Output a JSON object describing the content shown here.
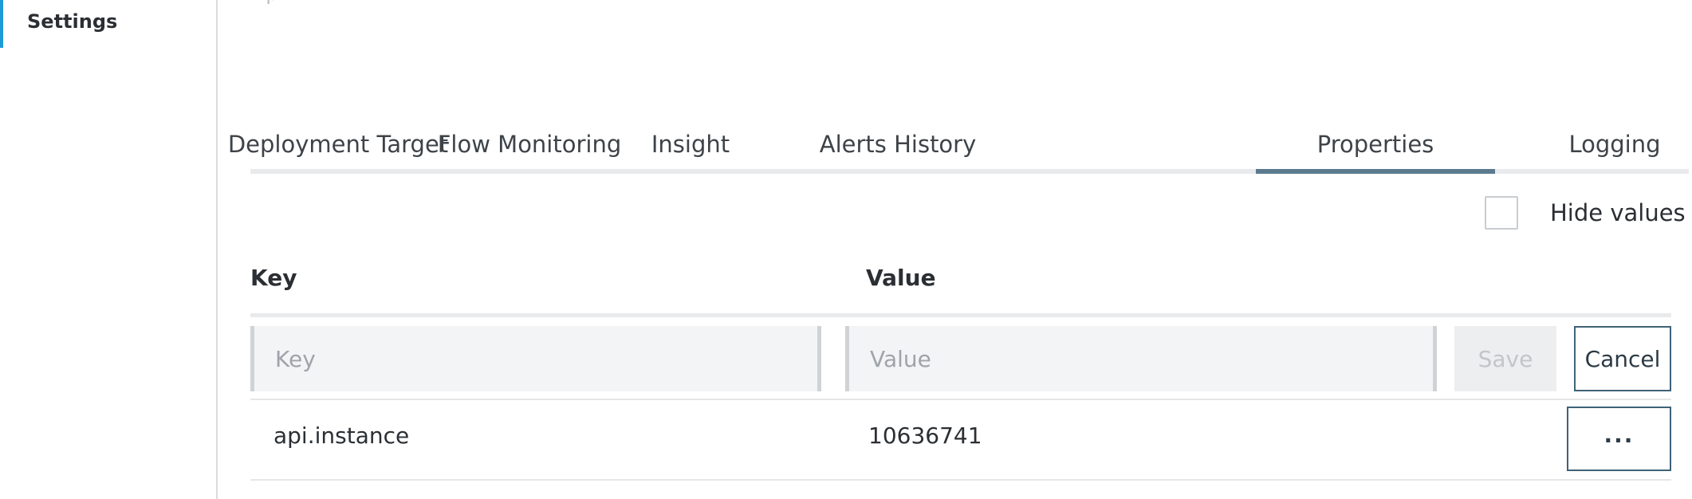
{
  "sidebar": {
    "items": [
      {
        "label": "Settings",
        "active": true
      }
    ]
  },
  "main": {
    "header_partial_text": "Ap",
    "tabs": [
      {
        "label": "Deployment Target",
        "active": false
      },
      {
        "label": "Flow Monitoring",
        "active": false
      },
      {
        "label": "Insight",
        "active": false
      },
      {
        "label": "Alerts History",
        "active": false
      },
      {
        "label": "Properties",
        "active": true
      },
      {
        "label": "Logging",
        "active": false
      }
    ],
    "hide_values": {
      "label": "Hide values",
      "checked": false
    },
    "table": {
      "columns": [
        "Key",
        "Value"
      ],
      "new_row": {
        "key_placeholder": "Key",
        "value_placeholder": "Value",
        "save_label": "Save",
        "cancel_label": "Cancel"
      },
      "rows": [
        {
          "key": "api.instance",
          "value": "10636741",
          "menu_label": "..."
        }
      ]
    }
  },
  "colors": {
    "accent_sidebar": "#1e9ad6",
    "active_tab_underline": "#5b7a8e",
    "button_border": "#3f6277"
  }
}
